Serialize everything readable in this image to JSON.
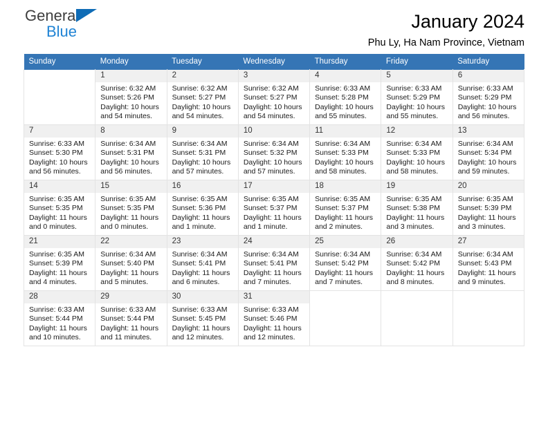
{
  "brand": {
    "name_top": "General",
    "name_bottom": "Blue",
    "triangle_color": "#0f6cb6",
    "top_color": "#3d3d3d",
    "bottom_color": "#1f83d4"
  },
  "header": {
    "title": "January 2024",
    "subtitle": "Phu Ly, Ha Nam Province, Vietnam"
  },
  "theme": {
    "header_bg": "#3575b5",
    "daynum_bg": "#f0f0f0",
    "border": "#e3e3e3"
  },
  "weekdays": [
    "Sunday",
    "Monday",
    "Tuesday",
    "Wednesday",
    "Thursday",
    "Friday",
    "Saturday"
  ],
  "weeks": [
    [
      {
        "day": "",
        "blank": true
      },
      {
        "day": "1",
        "sunrise": "Sunrise: 6:32 AM",
        "sunset": "Sunset: 5:26 PM",
        "daylight1": "Daylight: 10 hours",
        "daylight2": "and 54 minutes."
      },
      {
        "day": "2",
        "sunrise": "Sunrise: 6:32 AM",
        "sunset": "Sunset: 5:27 PM",
        "daylight1": "Daylight: 10 hours",
        "daylight2": "and 54 minutes."
      },
      {
        "day": "3",
        "sunrise": "Sunrise: 6:32 AM",
        "sunset": "Sunset: 5:27 PM",
        "daylight1": "Daylight: 10 hours",
        "daylight2": "and 54 minutes."
      },
      {
        "day": "4",
        "sunrise": "Sunrise: 6:33 AM",
        "sunset": "Sunset: 5:28 PM",
        "daylight1": "Daylight: 10 hours",
        "daylight2": "and 55 minutes."
      },
      {
        "day": "5",
        "sunrise": "Sunrise: 6:33 AM",
        "sunset": "Sunset: 5:29 PM",
        "daylight1": "Daylight: 10 hours",
        "daylight2": "and 55 minutes."
      },
      {
        "day": "6",
        "sunrise": "Sunrise: 6:33 AM",
        "sunset": "Sunset: 5:29 PM",
        "daylight1": "Daylight: 10 hours",
        "daylight2": "and 56 minutes."
      }
    ],
    [
      {
        "day": "7",
        "sunrise": "Sunrise: 6:33 AM",
        "sunset": "Sunset: 5:30 PM",
        "daylight1": "Daylight: 10 hours",
        "daylight2": "and 56 minutes."
      },
      {
        "day": "8",
        "sunrise": "Sunrise: 6:34 AM",
        "sunset": "Sunset: 5:31 PM",
        "daylight1": "Daylight: 10 hours",
        "daylight2": "and 56 minutes."
      },
      {
        "day": "9",
        "sunrise": "Sunrise: 6:34 AM",
        "sunset": "Sunset: 5:31 PM",
        "daylight1": "Daylight: 10 hours",
        "daylight2": "and 57 minutes."
      },
      {
        "day": "10",
        "sunrise": "Sunrise: 6:34 AM",
        "sunset": "Sunset: 5:32 PM",
        "daylight1": "Daylight: 10 hours",
        "daylight2": "and 57 minutes."
      },
      {
        "day": "11",
        "sunrise": "Sunrise: 6:34 AM",
        "sunset": "Sunset: 5:33 PM",
        "daylight1": "Daylight: 10 hours",
        "daylight2": "and 58 minutes."
      },
      {
        "day": "12",
        "sunrise": "Sunrise: 6:34 AM",
        "sunset": "Sunset: 5:33 PM",
        "daylight1": "Daylight: 10 hours",
        "daylight2": "and 58 minutes."
      },
      {
        "day": "13",
        "sunrise": "Sunrise: 6:34 AM",
        "sunset": "Sunset: 5:34 PM",
        "daylight1": "Daylight: 10 hours",
        "daylight2": "and 59 minutes."
      }
    ],
    [
      {
        "day": "14",
        "sunrise": "Sunrise: 6:35 AM",
        "sunset": "Sunset: 5:35 PM",
        "daylight1": "Daylight: 11 hours",
        "daylight2": "and 0 minutes."
      },
      {
        "day": "15",
        "sunrise": "Sunrise: 6:35 AM",
        "sunset": "Sunset: 5:35 PM",
        "daylight1": "Daylight: 11 hours",
        "daylight2": "and 0 minutes."
      },
      {
        "day": "16",
        "sunrise": "Sunrise: 6:35 AM",
        "sunset": "Sunset: 5:36 PM",
        "daylight1": "Daylight: 11 hours",
        "daylight2": "and 1 minute."
      },
      {
        "day": "17",
        "sunrise": "Sunrise: 6:35 AM",
        "sunset": "Sunset: 5:37 PM",
        "daylight1": "Daylight: 11 hours",
        "daylight2": "and 1 minute."
      },
      {
        "day": "18",
        "sunrise": "Sunrise: 6:35 AM",
        "sunset": "Sunset: 5:37 PM",
        "daylight1": "Daylight: 11 hours",
        "daylight2": "and 2 minutes."
      },
      {
        "day": "19",
        "sunrise": "Sunrise: 6:35 AM",
        "sunset": "Sunset: 5:38 PM",
        "daylight1": "Daylight: 11 hours",
        "daylight2": "and 3 minutes."
      },
      {
        "day": "20",
        "sunrise": "Sunrise: 6:35 AM",
        "sunset": "Sunset: 5:39 PM",
        "daylight1": "Daylight: 11 hours",
        "daylight2": "and 3 minutes."
      }
    ],
    [
      {
        "day": "21",
        "sunrise": "Sunrise: 6:35 AM",
        "sunset": "Sunset: 5:39 PM",
        "daylight1": "Daylight: 11 hours",
        "daylight2": "and 4 minutes."
      },
      {
        "day": "22",
        "sunrise": "Sunrise: 6:34 AM",
        "sunset": "Sunset: 5:40 PM",
        "daylight1": "Daylight: 11 hours",
        "daylight2": "and 5 minutes."
      },
      {
        "day": "23",
        "sunrise": "Sunrise: 6:34 AM",
        "sunset": "Sunset: 5:41 PM",
        "daylight1": "Daylight: 11 hours",
        "daylight2": "and 6 minutes."
      },
      {
        "day": "24",
        "sunrise": "Sunrise: 6:34 AM",
        "sunset": "Sunset: 5:41 PM",
        "daylight1": "Daylight: 11 hours",
        "daylight2": "and 7 minutes."
      },
      {
        "day": "25",
        "sunrise": "Sunrise: 6:34 AM",
        "sunset": "Sunset: 5:42 PM",
        "daylight1": "Daylight: 11 hours",
        "daylight2": "and 7 minutes."
      },
      {
        "day": "26",
        "sunrise": "Sunrise: 6:34 AM",
        "sunset": "Sunset: 5:42 PM",
        "daylight1": "Daylight: 11 hours",
        "daylight2": "and 8 minutes."
      },
      {
        "day": "27",
        "sunrise": "Sunrise: 6:34 AM",
        "sunset": "Sunset: 5:43 PM",
        "daylight1": "Daylight: 11 hours",
        "daylight2": "and 9 minutes."
      }
    ],
    [
      {
        "day": "28",
        "sunrise": "Sunrise: 6:33 AM",
        "sunset": "Sunset: 5:44 PM",
        "daylight1": "Daylight: 11 hours",
        "daylight2": "and 10 minutes."
      },
      {
        "day": "29",
        "sunrise": "Sunrise: 6:33 AM",
        "sunset": "Sunset: 5:44 PM",
        "daylight1": "Daylight: 11 hours",
        "daylight2": "and 11 minutes."
      },
      {
        "day": "30",
        "sunrise": "Sunrise: 6:33 AM",
        "sunset": "Sunset: 5:45 PM",
        "daylight1": "Daylight: 11 hours",
        "daylight2": "and 12 minutes."
      },
      {
        "day": "31",
        "sunrise": "Sunrise: 6:33 AM",
        "sunset": "Sunset: 5:46 PM",
        "daylight1": "Daylight: 11 hours",
        "daylight2": "and 12 minutes."
      },
      {
        "day": "",
        "blank": true
      },
      {
        "day": "",
        "blank": true
      },
      {
        "day": "",
        "blank": true
      }
    ]
  ]
}
